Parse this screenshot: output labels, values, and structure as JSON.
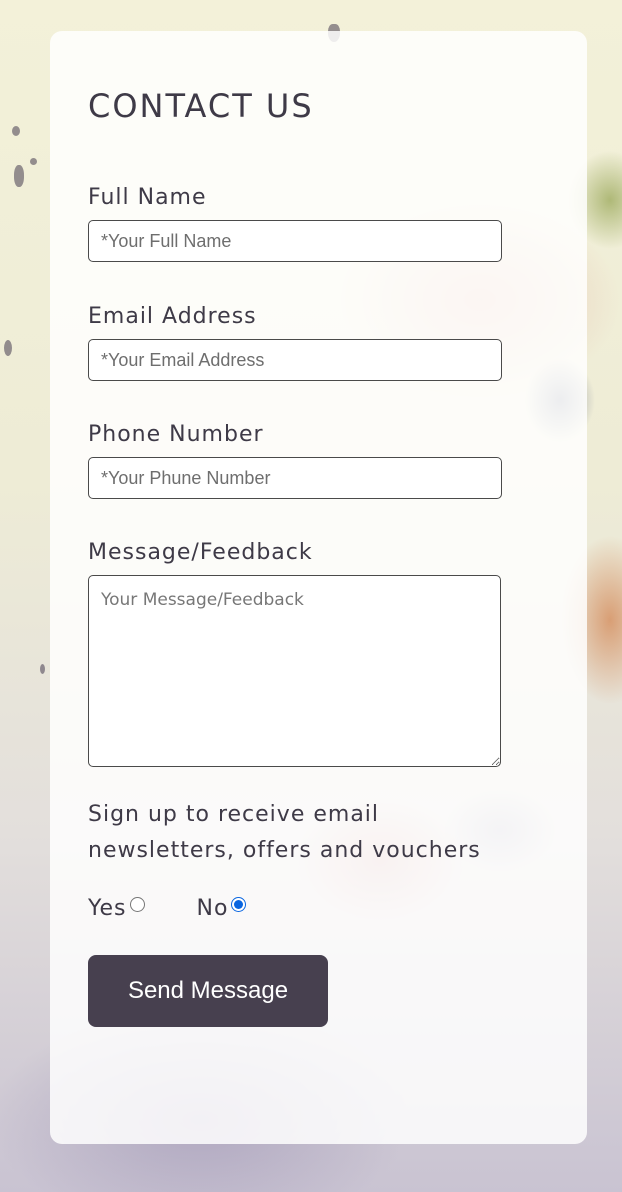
{
  "form": {
    "title": "CONTACT US",
    "full_name": {
      "label": "Full Name",
      "placeholder": "*Your Full Name",
      "value": ""
    },
    "email": {
      "label": "Email Address",
      "placeholder": "*Your Email Address",
      "value": ""
    },
    "phone": {
      "label": "Phone Number",
      "placeholder": "*Your Phune Number",
      "value": ""
    },
    "message": {
      "label": "Message/Feedback",
      "placeholder": "Your Message/Feedback",
      "value": ""
    },
    "newsletter": {
      "prompt": "Sign up to receive email newsletters, offers and vouchers",
      "options": [
        {
          "label": "Yes",
          "selected": false
        },
        {
          "label": "No",
          "selected": true
        }
      ]
    },
    "submit_label": "Send Message"
  },
  "colors": {
    "text": "#3e3a47",
    "button_bg": "#47404f",
    "button_text": "#ffffff",
    "radio_accent": "#0a66e0"
  }
}
